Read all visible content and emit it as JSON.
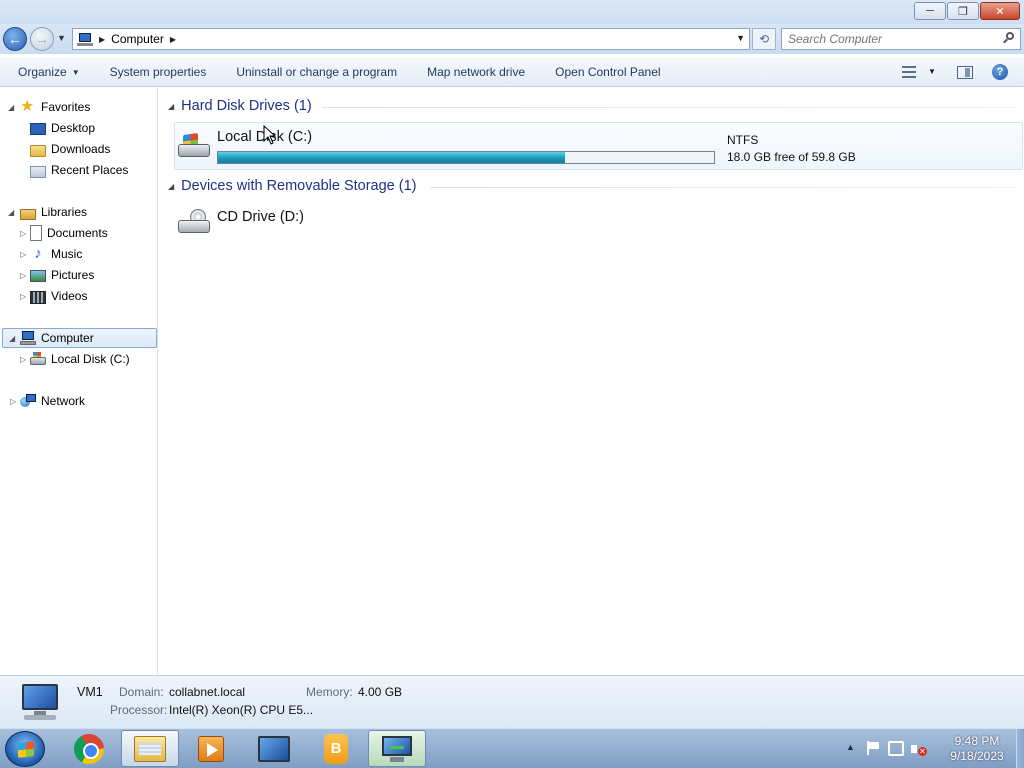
{
  "window": {
    "minimize_glyph": "─",
    "maximize_glyph": "❐",
    "close_glyph": "✕"
  },
  "address": {
    "breadcrumb": [
      "Computer"
    ],
    "search_placeholder": "Search Computer"
  },
  "toolbar": {
    "organize": "Organize",
    "system_properties": "System properties",
    "uninstall": "Uninstall or change a program",
    "map_drive": "Map network drive",
    "control_panel": "Open Control Panel"
  },
  "nav": {
    "favorites": "Favorites",
    "desktop": "Desktop",
    "downloads": "Downloads",
    "recent_places": "Recent Places",
    "libraries": "Libraries",
    "documents": "Documents",
    "music": "Music",
    "pictures": "Pictures",
    "videos": "Videos",
    "computer": "Computer",
    "local_disk": "Local Disk (C:)",
    "network": "Network"
  },
  "content": {
    "hard_disk_group": "Hard Disk Drives (1)",
    "removable_group": "Devices with Removable Storage (1)",
    "drive_c": {
      "name": "Local Disk (C:)",
      "filesystem": "NTFS",
      "free_text": "18.0 GB free of 59.8 GB",
      "used_fraction": 0.699
    },
    "drive_d": {
      "name": "CD Drive (D:)"
    }
  },
  "details": {
    "computer_name": "VM1",
    "domain_label": "Domain:",
    "domain_value": "collabnet.local",
    "memory_label": "Memory:",
    "memory_value": "4.00 GB",
    "processor_label": "Processor:",
    "processor_value": "Intel(R) Xeon(R) CPU E5..."
  },
  "taskbar": {
    "time": "9:48 PM",
    "date": "9/18/2023",
    "apps": [
      "start",
      "chrome",
      "windows-explorer",
      "media-player",
      "remote-desktop",
      "signal",
      "computer-management"
    ]
  },
  "colors": {
    "accent": "#1e3287",
    "usage_bar": "#1a9ab9",
    "selection_border": "#84acdd"
  }
}
